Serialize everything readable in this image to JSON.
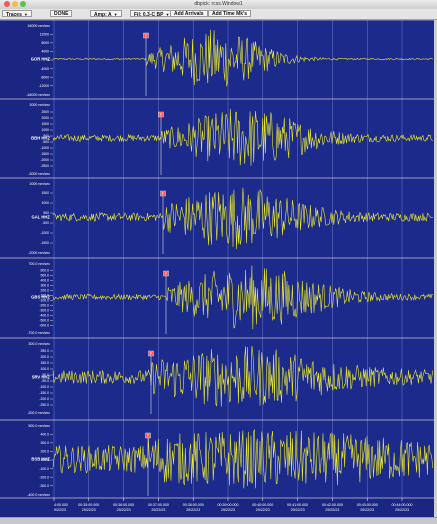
{
  "window": {
    "title": "dbpick: rcss.Window1"
  },
  "toolbar": {
    "traces": "Traces",
    "done": "DONE",
    "amp": "Amp: A",
    "filter": "Fil: 0.3-C BP",
    "add_arrivals": "Add Arrivals",
    "add_time_mk": "Add Time Mk's"
  },
  "colors": {
    "background": "#1c2a8c",
    "trace": "#ecec28",
    "pick_marker": "#ff5555",
    "text": "#ffffff"
  },
  "traces": [
    {
      "station": "GOR HHZ",
      "scale_top": "16000 nm/sec",
      "scale_bottom": "-16000 nm/sec",
      "ticks": [
        "12000",
        "8000",
        "4000",
        "0",
        "-4000",
        "-8000",
        "-12000"
      ],
      "pick": "P"
    },
    {
      "station": "BBH HHZ",
      "scale_top": "3000 nm/sec",
      "scale_bottom": "-3000 nm/sec",
      "ticks": [
        "2500",
        "2000",
        "1500",
        "1000",
        "500",
        "-500",
        "-1000",
        "-1500",
        "-2000",
        "-2500"
      ],
      "pick": "P"
    },
    {
      "station": "GAL HHZ",
      "scale_top": "2000 nm/sec",
      "scale_bottom": "-2000 nm/sec",
      "ticks": [
        "1500",
        "1000",
        "500",
        "-500",
        "-1000",
        "-1500"
      ],
      "pick": "P"
    },
    {
      "station": "GBS HHZ",
      "scale_top": "700.0 nm/sec",
      "scale_bottom": "-700.0 nm/sec",
      "ticks": [
        "600.0",
        "500.0",
        "400.0",
        "300.0",
        "200.0",
        "100.0",
        "-100.0",
        "-200.0",
        "-300.0",
        "-400.0",
        "-500.0",
        "-600.0"
      ],
      "pick": "P"
    },
    {
      "station": "SRV HHZ",
      "scale_top": "300.0 nm/sec",
      "scale_bottom": "-300.0 nm/sec",
      "ticks": [
        "250.0",
        "200.0",
        "150.0",
        "100.0",
        "50.0",
        "-50.0",
        "-100.0",
        "-150.0",
        "-200.0",
        "-250.0"
      ],
      "pick": "P"
    },
    {
      "station": "BSB HHZ",
      "scale_top": "500.0 nm/sec",
      "scale_bottom": "-400.0 nm/sec",
      "ticks": [
        "400.0",
        "300.0",
        "200.0",
        "100.0",
        "-100.0",
        "-200.0",
        "-300.0"
      ],
      "pick": "P"
    }
  ],
  "time_axis": [
    {
      "time": "4:00.000",
      "date": "9/22/23"
    },
    {
      "time": "00:35:00.000",
      "date": "29/22/23"
    },
    {
      "time": "00:36:00.000",
      "date": "29/22/23"
    },
    {
      "time": "00:37:00.000",
      "date": "29/22/23"
    },
    {
      "time": "00:38:00.000",
      "date": "29/22/23"
    },
    {
      "time": "00:39:00.000",
      "date": "29/22/23"
    },
    {
      "time": "00:40:00.000",
      "date": "29/22/23"
    },
    {
      "time": "00:41:00.000",
      "date": "29/22/23"
    },
    {
      "time": "00:42:00.000",
      "date": "29/22/23"
    },
    {
      "time": "00:43:00.000",
      "date": "29/22/23"
    },
    {
      "time": "00:44:00.000",
      "date": "29/22/23"
    }
  ]
}
